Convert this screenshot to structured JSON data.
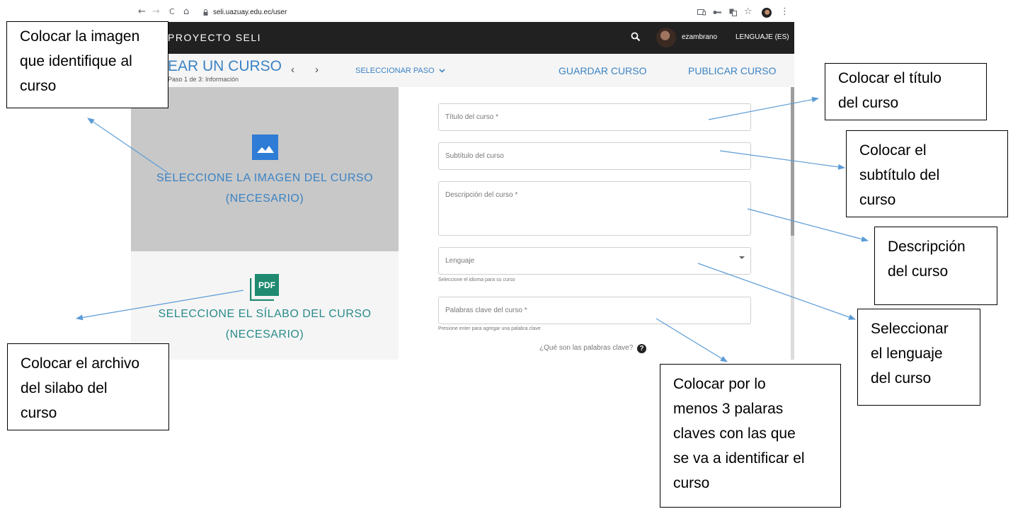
{
  "browser": {
    "back_glyph": "←",
    "forward_glyph": "→",
    "reload_glyph": "C",
    "home_glyph": "⌂",
    "url": "seli.uazuay.edu.ec/user",
    "star_glyph": "☆",
    "menu_glyph": "⋮"
  },
  "app": {
    "brand": "PROYECTO SELI",
    "username": "ezambrano",
    "language_button": "LENGUAJE (ES)",
    "page_title": "EAR UN CURSO",
    "step_text": "Paso 1 de 3: Información",
    "prev_glyph": "‹",
    "next_glyph": "›",
    "select_step": "SELECCIONAR PASO",
    "save": "GUARDAR CURSO",
    "publish": "PUBLICAR CURSO"
  },
  "image_panel": {
    "line1": "SELECCIONE LA IMAGEN DEL CURSO",
    "line2": "(NECESARIO)"
  },
  "syllabus_panel": {
    "icon_text": "PDF",
    "line1": "SELECCIONE EL SÍLABO DEL CURSO",
    "line2": "(NECESARIO)"
  },
  "form": {
    "title_label": "Título del curso *",
    "subtitle_label": "Subtítulo del curso",
    "description_label": "Descripción del curso *",
    "language_label": "Lenguaje",
    "language_help": "Seleccione el idioma para su curso",
    "keywords_label": "Palabras clave del curso *",
    "keywords_help": "Presione enter para agregar una palabra clave",
    "keywords_question": "¿Qué son las palabras clave?",
    "question_glyph": "?"
  },
  "callouts": {
    "image": [
      "Colocar la imagen",
      "que identifique al",
      "curso"
    ],
    "title": [
      "Colocar el título",
      "del curso"
    ],
    "subtitle": [
      "Colocar el",
      "subtítulo del",
      "curso"
    ],
    "description": [
      "Descripción",
      "del curso"
    ],
    "language": [
      "Seleccionar",
      "el lenguaje",
      "del curso"
    ],
    "syllabus": [
      "Colocar el archivo",
      "del silabo del",
      "curso"
    ],
    "keywords": [
      "Colocar por lo",
      "menos 3 palaras",
      "claves con las que",
      "se va a identificar el",
      "curso"
    ]
  },
  "colors": {
    "accent_blue": "#3b83c4",
    "topbar": "#212121",
    "arrow": "#5b9bd5",
    "pdf_green": "#1f8a70"
  }
}
